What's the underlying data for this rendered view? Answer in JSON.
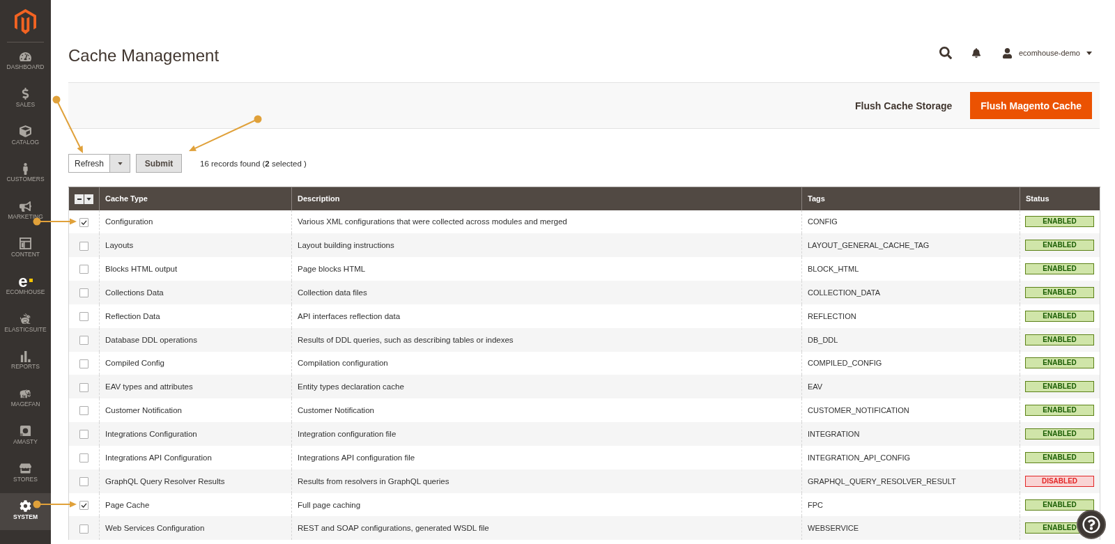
{
  "sidebar": {
    "items": [
      {
        "label": "DASHBOARD",
        "selected": false
      },
      {
        "label": "SALES",
        "selected": false
      },
      {
        "label": "CATALOG",
        "selected": false
      },
      {
        "label": "CUSTOMERS",
        "selected": false
      },
      {
        "label": "MARKETING",
        "selected": false
      },
      {
        "label": "CONTENT",
        "selected": false
      },
      {
        "label": "ECOMHOUSE",
        "glyph": "e",
        "selected": false
      },
      {
        "label": "ELASTICSUITE",
        "selected": false
      },
      {
        "label": "REPORTS",
        "selected": false
      },
      {
        "label": "MAGEFAN",
        "selected": false
      },
      {
        "label": "AMASTY",
        "selected": false
      },
      {
        "label": "STORES",
        "selected": false
      },
      {
        "label": "SYSTEM",
        "selected": true
      }
    ]
  },
  "header": {
    "title": "Cache Management",
    "user": "ecomhouse-demo"
  },
  "page_actions": [
    {
      "label": "Flush Cache Storage",
      "kind": "secondary"
    },
    {
      "label": "Flush Magento Cache",
      "kind": "primary"
    }
  ],
  "mass_action": {
    "value": "Refresh",
    "submit": "Submit",
    "summary": "16 records found (**2** selected )"
  },
  "table": {
    "select_all": {
      "indeterminate": true
    },
    "columns": [
      "Cache Type",
      "Description",
      "Tags",
      "Status"
    ],
    "rows": [
      {
        "checked": true,
        "cache_type": "Configuration",
        "description": "Various XML configurations that were collected across modules and merged",
        "tags": "CONFIG",
        "status": {
          "label": "ENABLED",
          "enabled": true
        }
      },
      {
        "checked": false,
        "cache_type": "Layouts",
        "description": "Layout building instructions",
        "tags": "LAYOUT_GENERAL_CACHE_TAG",
        "status": {
          "label": "ENABLED",
          "enabled": true
        }
      },
      {
        "checked": false,
        "cache_type": "Blocks HTML output",
        "description": "Page blocks HTML",
        "tags": "BLOCK_HTML",
        "status": {
          "label": "ENABLED",
          "enabled": true
        }
      },
      {
        "checked": false,
        "cache_type": "Collections Data",
        "description": "Collection data files",
        "tags": "COLLECTION_DATA",
        "status": {
          "label": "ENABLED",
          "enabled": true
        }
      },
      {
        "checked": false,
        "cache_type": "Reflection Data",
        "description": "API interfaces reflection data",
        "tags": "REFLECTION",
        "status": {
          "label": "ENABLED",
          "enabled": true
        }
      },
      {
        "checked": false,
        "cache_type": "Database DDL operations",
        "description": "Results of DDL queries, such as describing tables or indexes",
        "tags": "DB_DDL",
        "status": {
          "label": "ENABLED",
          "enabled": true
        }
      },
      {
        "checked": false,
        "cache_type": "Compiled Config",
        "description": "Compilation configuration",
        "tags": "COMPILED_CONFIG",
        "status": {
          "label": "ENABLED",
          "enabled": true
        }
      },
      {
        "checked": false,
        "cache_type": "EAV types and attributes",
        "description": "Entity types declaration cache",
        "tags": "EAV",
        "status": {
          "label": "ENABLED",
          "enabled": true
        }
      },
      {
        "checked": false,
        "cache_type": "Customer Notification",
        "description": "Customer Notification",
        "tags": "CUSTOMER_NOTIFICATION",
        "status": {
          "label": "ENABLED",
          "enabled": true
        }
      },
      {
        "checked": false,
        "cache_type": "Integrations Configuration",
        "description": "Integration configuration file",
        "tags": "INTEGRATION",
        "status": {
          "label": "ENABLED",
          "enabled": true
        }
      },
      {
        "checked": false,
        "cache_type": "Integrations API Configuration",
        "description": "Integrations API configuration file",
        "tags": "INTEGRATION_API_CONFIG",
        "status": {
          "label": "ENABLED",
          "enabled": true
        }
      },
      {
        "checked": false,
        "cache_type": "GraphQL Query Resolver Results",
        "description": "Results from resolvers in GraphQL queries",
        "tags": "GRAPHQL_QUERY_RESOLVER_RESULT",
        "status": {
          "label": "DISABLED",
          "enabled": false
        }
      },
      {
        "checked": true,
        "cache_type": "Page Cache",
        "description": "Full page caching",
        "tags": "FPC",
        "status": {
          "label": "ENABLED",
          "enabled": true
        }
      },
      {
        "checked": false,
        "cache_type": "Web Services Configuration",
        "description": "REST and SOAP configurations, generated WSDL file",
        "tags": "WEBSERVICE",
        "status": {
          "label": "ENABLED",
          "enabled": true
        }
      }
    ]
  },
  "callouts": [
    {
      "kind": "arrow"
    },
    {
      "kind": "arrow"
    },
    {
      "kind": "arrow"
    },
    {
      "kind": "arrow"
    }
  ]
}
